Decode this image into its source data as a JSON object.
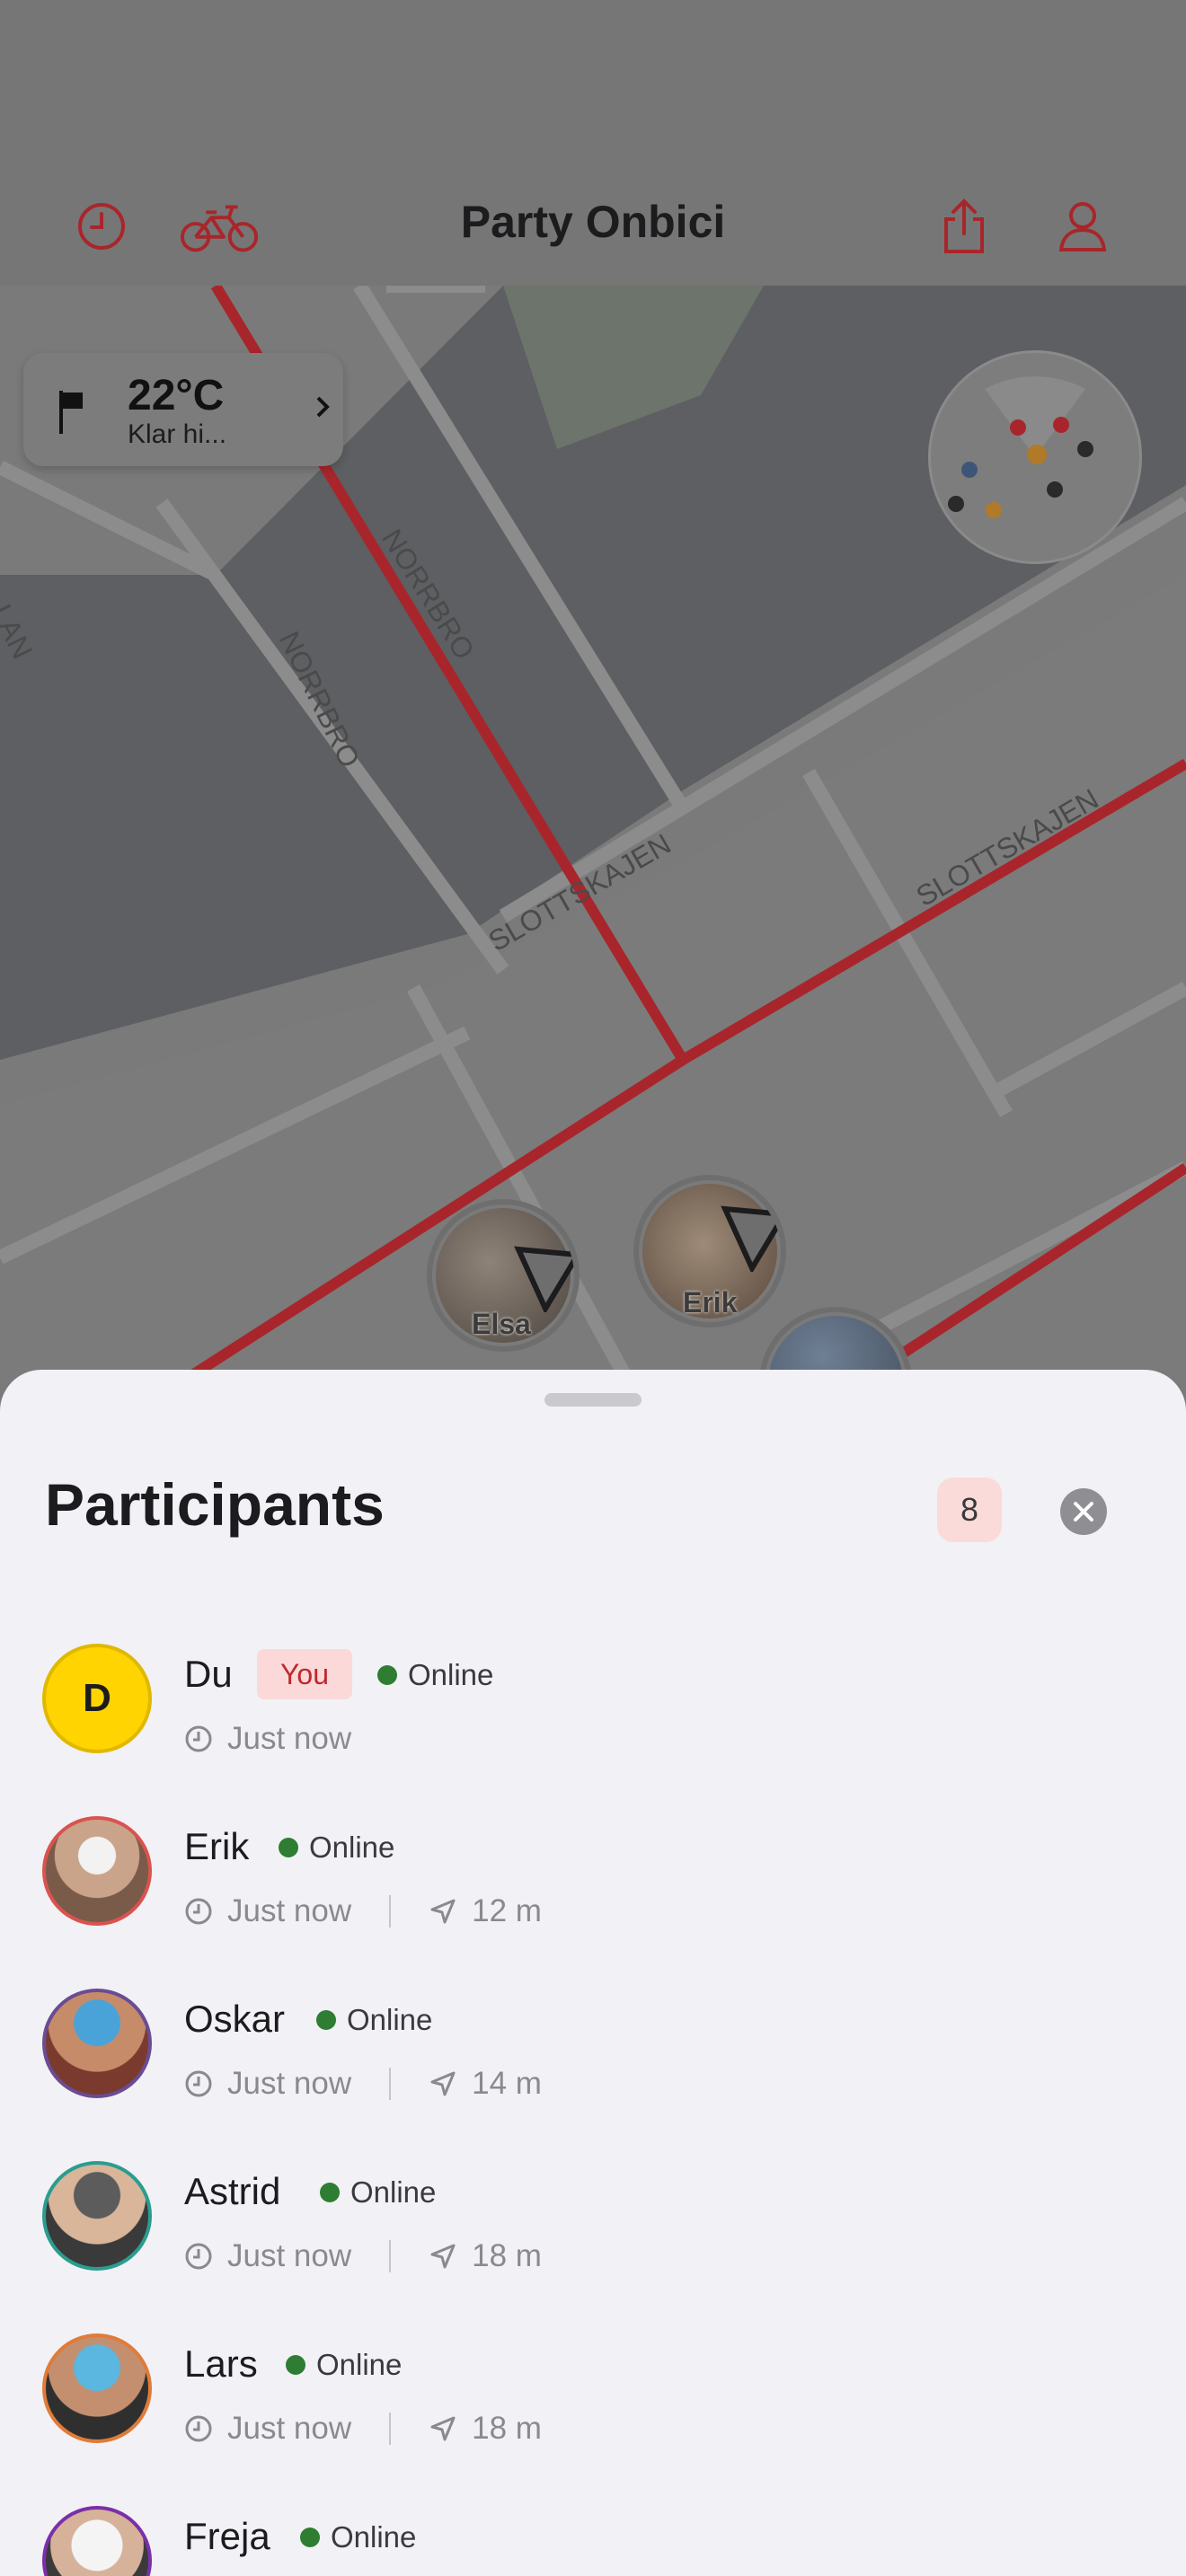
{
  "header": {
    "title": "Party Onbici",
    "accent": "#c0282e",
    "icons": [
      "history-clock-icon",
      "bike-icon",
      "share-icon",
      "profile-icon"
    ]
  },
  "weather": {
    "temp": "22°C",
    "condition": "Klar hi..."
  },
  "map": {
    "street_labels": [
      "NORRBRO",
      "NORRBRO",
      "SLOTTSKAJEN",
      "SLOTTSKAJEN",
      "LAN"
    ],
    "markers": [
      {
        "name": "Elsa"
      },
      {
        "name": "Erik"
      }
    ]
  },
  "sheet": {
    "title": "Participants",
    "count": "8",
    "you_label": "You",
    "online_label": "Online",
    "participants": [
      {
        "name": "Du",
        "initial": "D",
        "is_you": true,
        "status": "Online",
        "time": "Just now",
        "distance": "",
        "ring": "#e6c84a"
      },
      {
        "name": "Erik",
        "status": "Online",
        "time": "Just now",
        "distance": "12 m",
        "ring": "#d9534f"
      },
      {
        "name": "Oskar",
        "status": "Online",
        "time": "Just now",
        "distance": "14 m",
        "ring": "#6a4c93"
      },
      {
        "name": "Astrid",
        "status": "Online",
        "time": "Just now",
        "distance": "18 m",
        "ring": "#2a9d8f"
      },
      {
        "name": "Lars",
        "status": "Online",
        "time": "Just now",
        "distance": "18 m",
        "ring": "#e07b39"
      },
      {
        "name": "Freja",
        "status": "Online",
        "time": "",
        "distance": "",
        "ring": "#7b2fa8"
      }
    ]
  }
}
